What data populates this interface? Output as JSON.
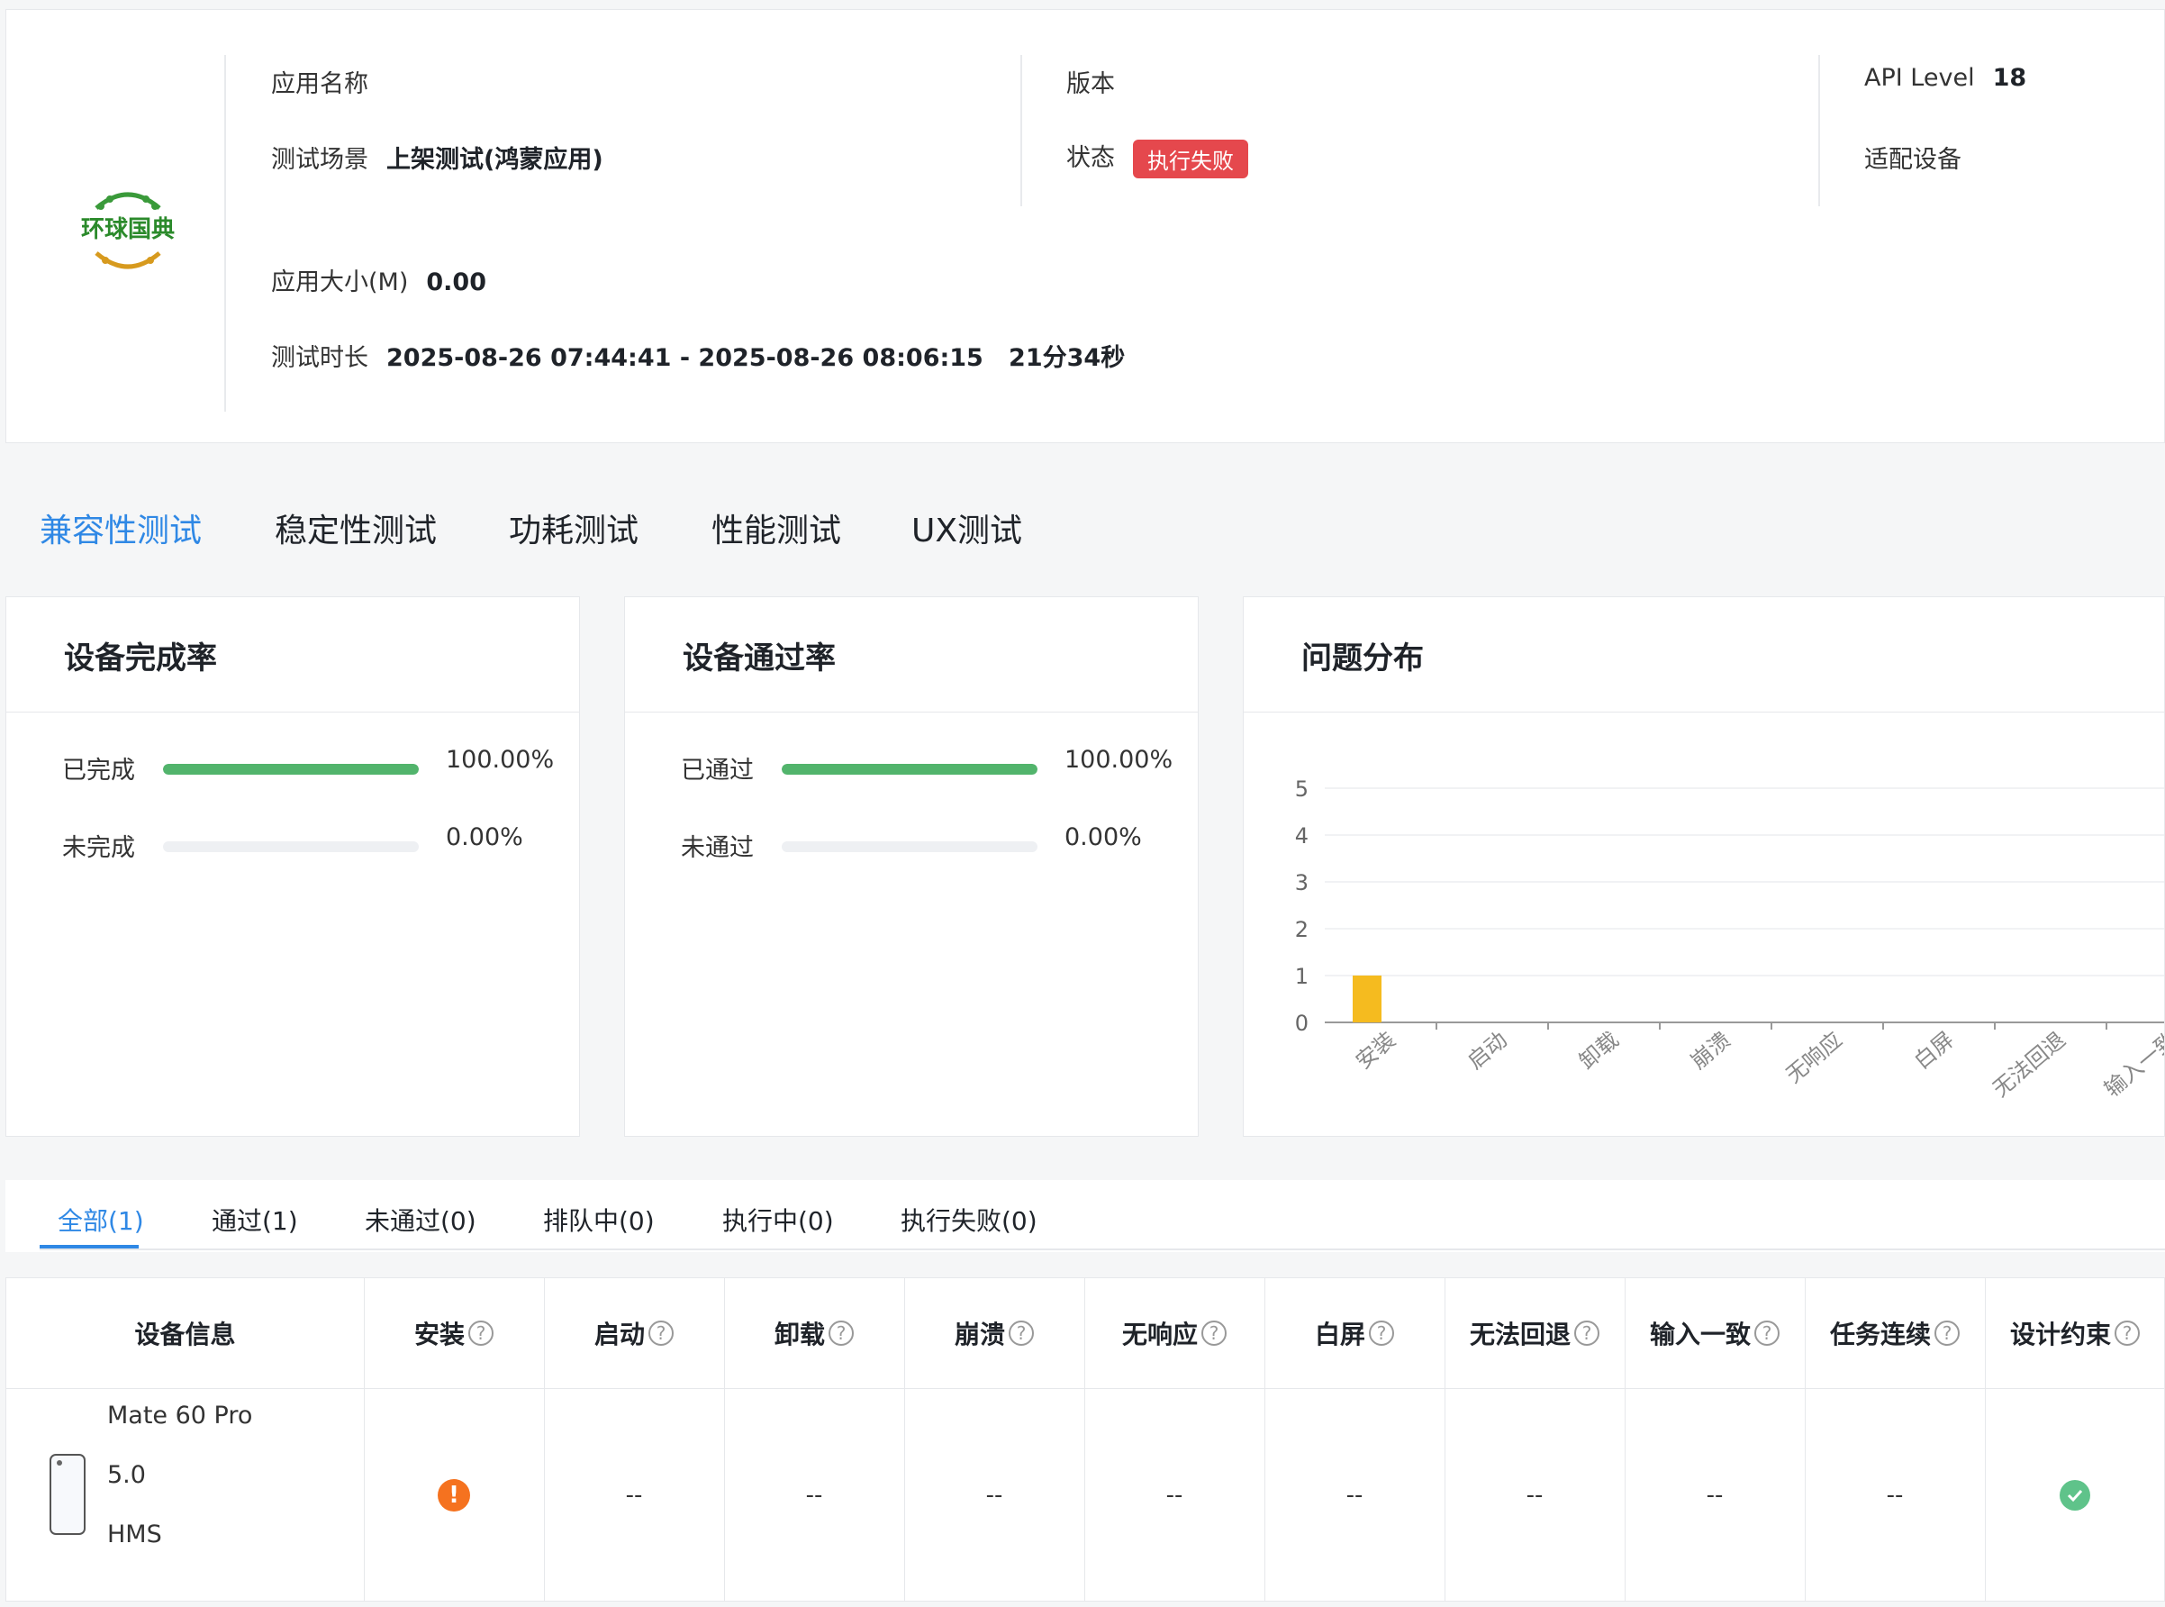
{
  "app_info": {
    "app_name_label": "应用名称",
    "version_label": "版本",
    "api_label": "API Level",
    "api_value": "18",
    "scene_label": "测试场景",
    "scene_value": "上架测试(鸿蒙应用)",
    "status_label": "状态",
    "status_value": "执行失败",
    "devices_label": "适配设备",
    "size_label": "应用大小(M)",
    "size_value": "0.00",
    "duration_label": "测试时长",
    "duration_value": "2025-08-26 07:44:41 - 2025-08-26 08:06:15   21分34秒",
    "logo_text": "环球国典"
  },
  "main_tabs": [
    "兼容性测试",
    "稳定性测试",
    "功耗测试",
    "性能测试",
    "UX测试"
  ],
  "completion": {
    "title": "设备完成率",
    "rows": [
      {
        "label": "已完成",
        "percent": "100.00%",
        "fraction": 1.0
      },
      {
        "label": "未完成",
        "percent": "0.00%",
        "fraction": 0.0
      }
    ]
  },
  "pass_rate": {
    "title": "设备通过率",
    "rows": [
      {
        "label": "已通过",
        "percent": "100.00%",
        "fraction": 1.0
      },
      {
        "label": "未通过",
        "percent": "0.00%",
        "fraction": 0.0
      }
    ]
  },
  "issue_panel": {
    "title": "问题分布"
  },
  "chart_data": {
    "type": "bar",
    "categories": [
      "安装",
      "启动",
      "卸载",
      "崩溃",
      "无响应",
      "白屏",
      "无法回退",
      "输入一致"
    ],
    "values": [
      1,
      0,
      0,
      0,
      0,
      0,
      0,
      0
    ],
    "yticks": [
      "0",
      "1",
      "2",
      "3",
      "4",
      "5"
    ],
    "ylim": [
      0,
      5
    ],
    "grid": true,
    "bar_color": "#f5bb1f"
  },
  "sub_tabs": [
    "全部(1)",
    "通过(1)",
    "未通过(0)",
    "排队中(0)",
    "执行中(0)",
    "执行失败(0)"
  ],
  "table": {
    "headers": [
      "设备信息",
      "安装",
      "启动",
      "卸载",
      "崩溃",
      "无响应",
      "白屏",
      "无法回退",
      "输入一致",
      "任务连续",
      "设计约束"
    ],
    "help_icon": "?",
    "row": {
      "device_name": "Mate 60 Pro",
      "device_os_version": "5.0",
      "device_platform": "HMS",
      "cells": [
        "warning-icon",
        "--",
        "--",
        "--",
        "--",
        "--",
        "--",
        "--",
        "--",
        "check-icon"
      ]
    }
  },
  "colors": {
    "accent": "#2f88e5",
    "progress": "#52b46c",
    "status_fail": "#e5484d",
    "warning": "#f5721f",
    "success": "#5fc38a"
  }
}
